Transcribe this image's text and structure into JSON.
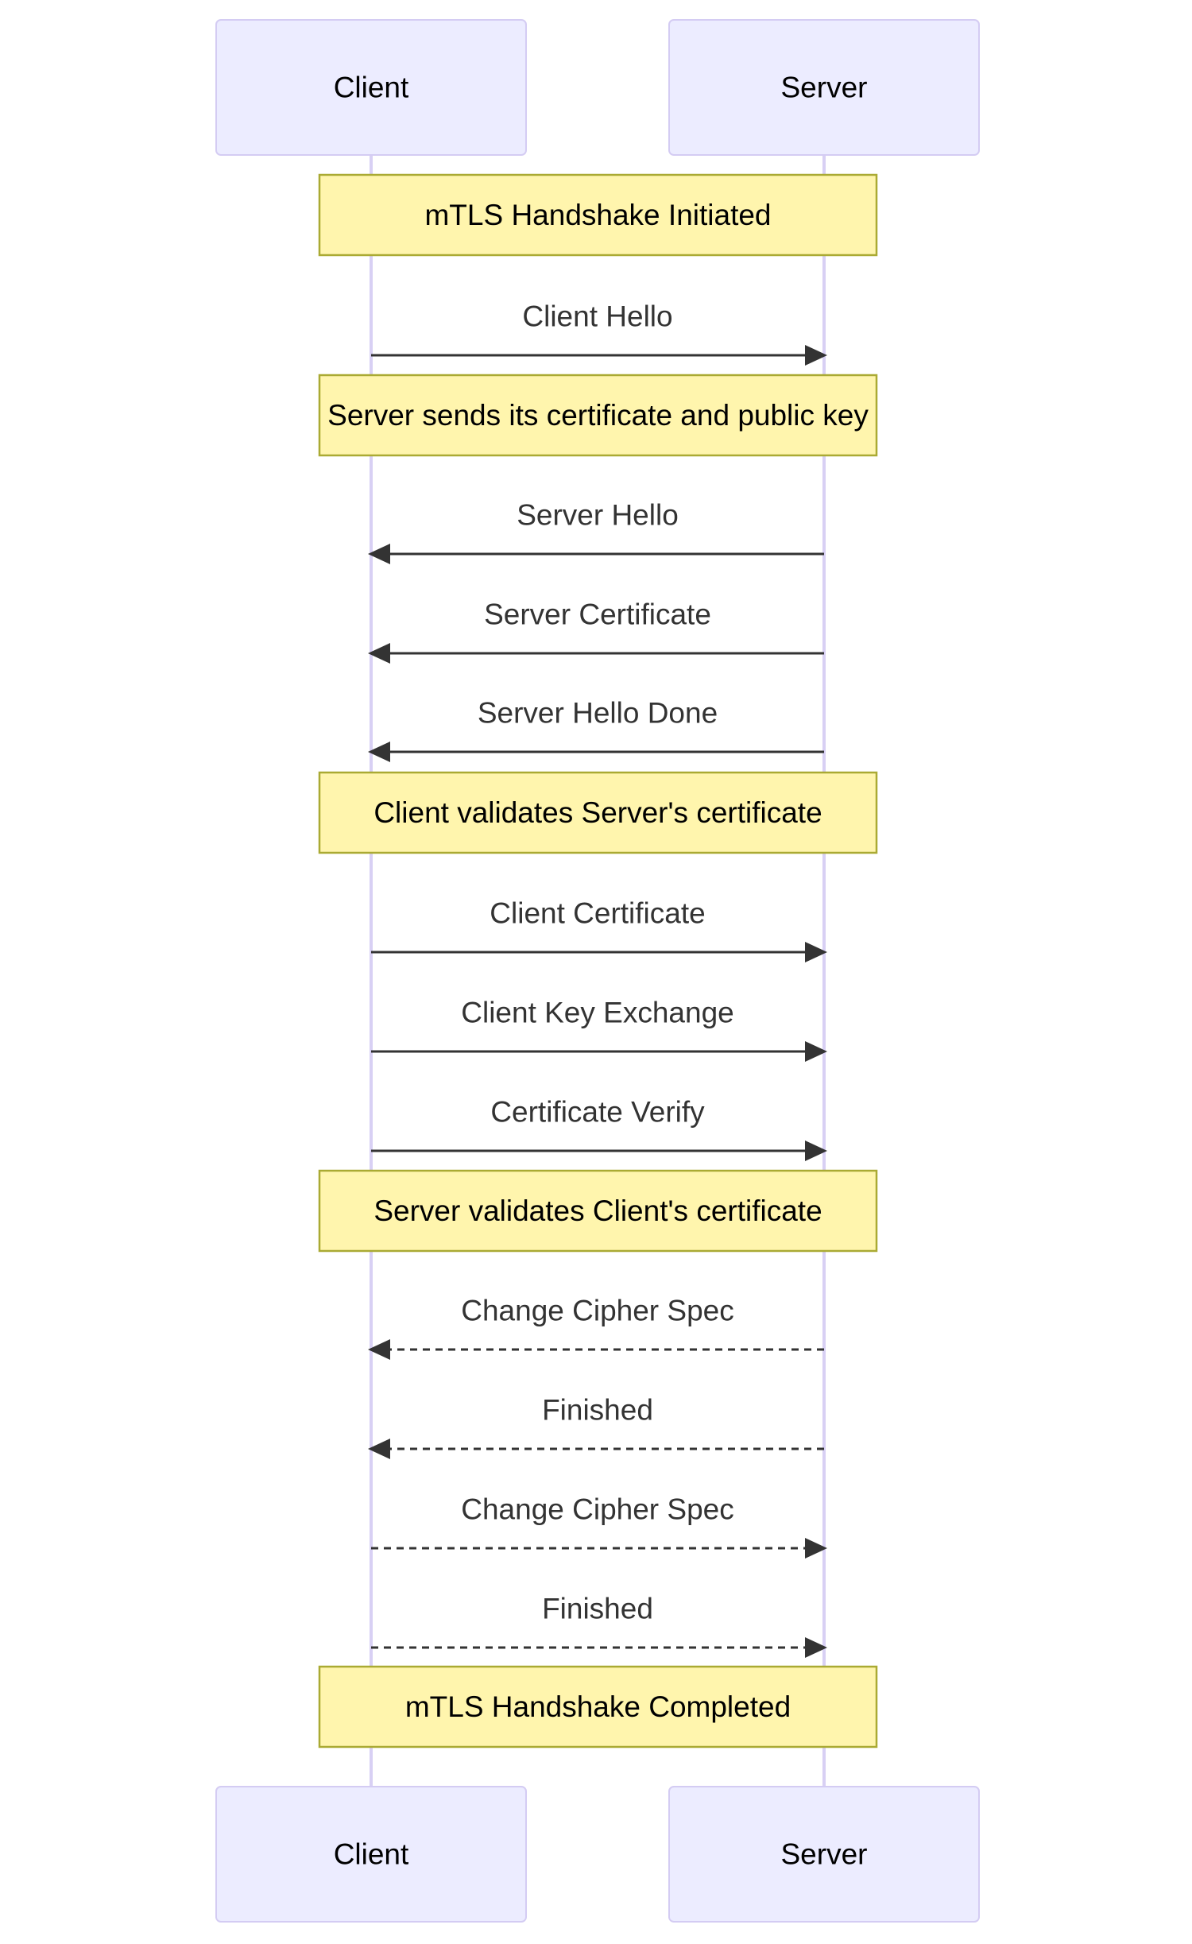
{
  "diagram": {
    "type": "sequence",
    "participants": [
      {
        "id": "client",
        "label": "Client"
      },
      {
        "id": "server",
        "label": "Server"
      }
    ],
    "steps": [
      {
        "kind": "note",
        "text": "mTLS Handshake Initiated"
      },
      {
        "kind": "message",
        "from": "client",
        "to": "server",
        "text": "Client Hello",
        "style": "solid"
      },
      {
        "kind": "note",
        "text": "Server sends its certificate and public key"
      },
      {
        "kind": "message",
        "from": "server",
        "to": "client",
        "text": "Server Hello",
        "style": "solid"
      },
      {
        "kind": "message",
        "from": "server",
        "to": "client",
        "text": "Server Certificate",
        "style": "solid"
      },
      {
        "kind": "message",
        "from": "server",
        "to": "client",
        "text": "Server Hello Done",
        "style": "solid"
      },
      {
        "kind": "note",
        "text": "Client validates Server's certificate"
      },
      {
        "kind": "message",
        "from": "client",
        "to": "server",
        "text": "Client Certificate",
        "style": "solid"
      },
      {
        "kind": "message",
        "from": "client",
        "to": "server",
        "text": "Client Key Exchange",
        "style": "solid"
      },
      {
        "kind": "message",
        "from": "client",
        "to": "server",
        "text": "Certificate Verify",
        "style": "solid"
      },
      {
        "kind": "note",
        "text": "Server validates Client's certificate"
      },
      {
        "kind": "message",
        "from": "server",
        "to": "client",
        "text": "Change Cipher Spec",
        "style": "dotted"
      },
      {
        "kind": "message",
        "from": "server",
        "to": "client",
        "text": "Finished",
        "style": "dotted"
      },
      {
        "kind": "message",
        "from": "client",
        "to": "server",
        "text": "Change Cipher Spec",
        "style": "dotted"
      },
      {
        "kind": "message",
        "from": "client",
        "to": "server",
        "text": "Finished",
        "style": "dotted"
      },
      {
        "kind": "note",
        "text": "mTLS Handshake Completed"
      }
    ]
  },
  "colors": {
    "actor_fill": "#ECECFF",
    "actor_border": "#D4CCF3",
    "lifeline": "#D8D0F4",
    "note_fill": "#FFF5AD",
    "note_border": "#AAAA33",
    "message_line": "#333333"
  }
}
